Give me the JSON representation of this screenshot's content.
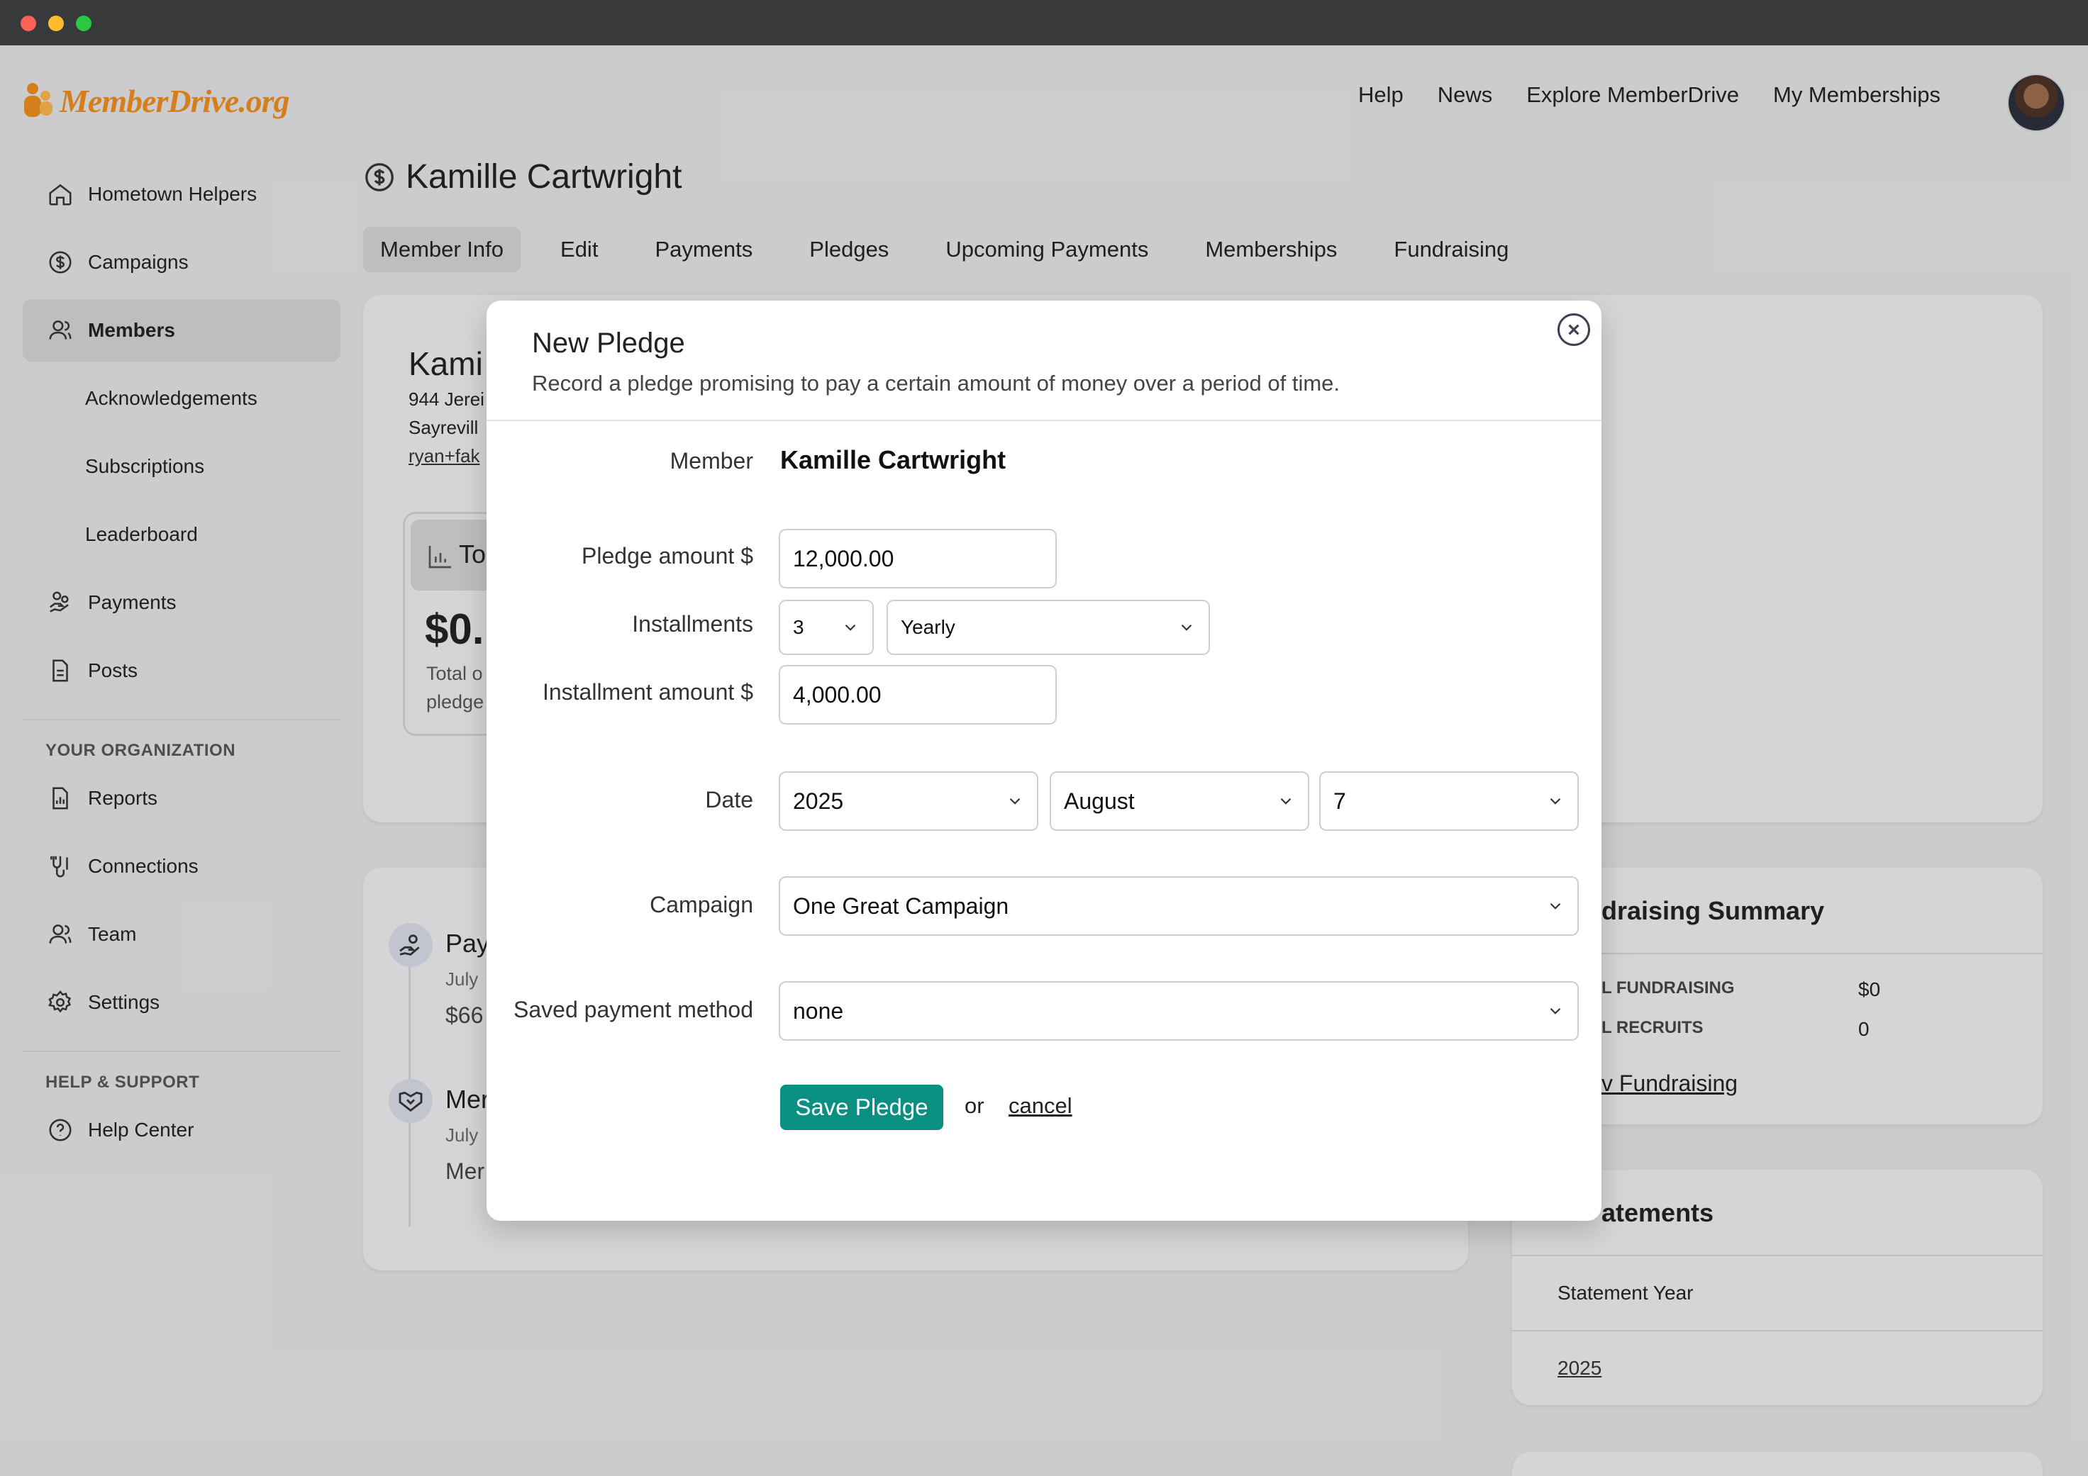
{
  "header": {
    "logo_text": "MemberDrive.org",
    "nav": [
      "Help",
      "News",
      "Explore MemberDrive",
      "My Memberships"
    ]
  },
  "sidebar": {
    "items": [
      {
        "label": "Hometown Helpers",
        "icon": "home-icon"
      },
      {
        "label": "Campaigns",
        "icon": "dollar-circle-icon"
      },
      {
        "label": "Members",
        "icon": "users-icon",
        "active": true
      },
      {
        "label": "Acknowledgements",
        "sub": true
      },
      {
        "label": "Subscriptions",
        "sub": true
      },
      {
        "label": "Leaderboard",
        "sub": true
      },
      {
        "label": "Payments",
        "icon": "hand-coins-icon"
      },
      {
        "label": "Posts",
        "icon": "document-icon"
      }
    ],
    "org_heading": "YOUR ORGANIZATION",
    "org_items": [
      {
        "label": "Reports",
        "icon": "chart-doc-icon"
      },
      {
        "label": "Connections",
        "icon": "connections-icon"
      },
      {
        "label": "Team",
        "icon": "users-icon"
      },
      {
        "label": "Settings",
        "icon": "gear-icon"
      }
    ],
    "help_heading": "HELP & SUPPORT",
    "help_items": [
      {
        "label": "Help Center",
        "icon": "help-circle-icon"
      }
    ]
  },
  "page": {
    "title": "Kamille Cartwright",
    "tabs": [
      "Member Info",
      "Edit",
      "Payments",
      "Pledges",
      "Upcoming Payments",
      "Memberships",
      "Fundraising"
    ],
    "active_tab": "Member Info"
  },
  "background": {
    "name_partial": "Kami",
    "address1_partial": "944 Jerei",
    "address2_partial": "Sayrevill",
    "email_partial": "ryan+fak",
    "stat_label_partial": "To",
    "stat_value_partial": "$0.",
    "stat_desc1_partial": "Total o",
    "stat_desc2_partial": "pledge",
    "feed": [
      {
        "title_partial": "Pay",
        "date_partial": "July",
        "amount_partial": "$66"
      },
      {
        "title_partial": "Mer",
        "date_partial": "July",
        "amount_partial": "Mer"
      }
    ],
    "fundraising": {
      "title_partial": "draising Summary",
      "row1_label": "L FUNDRAISING",
      "row1_value": "$0",
      "row2_label": "L RECRUITS",
      "row2_value": "0",
      "link_partial": "v Fundraising"
    },
    "statements": {
      "title_partial": "atements",
      "col": "Statement Year",
      "year": "2025"
    }
  },
  "modal": {
    "title": "New Pledge",
    "subtitle": "Record a pledge promising to pay a certain amount of money over a period of time.",
    "member_label": "Member",
    "member_value": "Kamille Cartwright",
    "amount_label": "Pledge amount $",
    "amount_value": "12,000.00",
    "installments_label": "Installments",
    "installments_count": "3",
    "installments_period": "Yearly",
    "inst_amount_label": "Installment amount $",
    "inst_amount_value": "4,000.00",
    "date_label": "Date",
    "date_year": "2025",
    "date_month": "August",
    "date_day": "7",
    "campaign_label": "Campaign",
    "campaign_value": "One Great Campaign",
    "payment_label": "Saved payment method",
    "payment_value": "none",
    "save_label": "Save Pledge",
    "or_text": "or",
    "cancel_label": "cancel"
  }
}
